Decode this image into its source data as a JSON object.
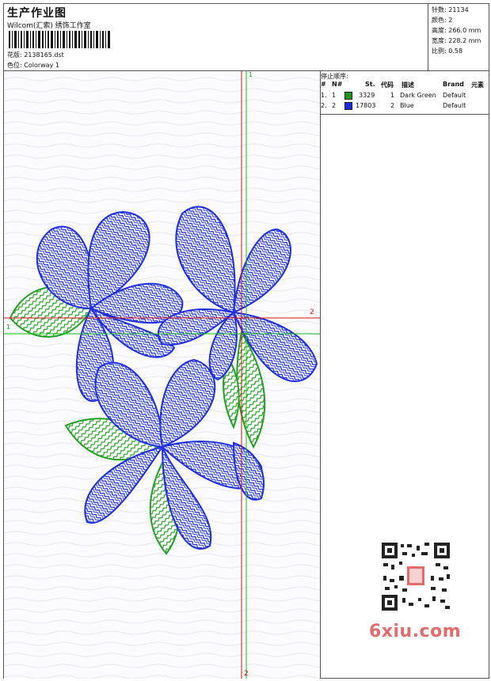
{
  "header": {
    "title": "生产作业图",
    "company": "Wilcom(汇索) 绣饰工作室",
    "design_label": "花版:",
    "design_value": "2138165.dst",
    "colorway_label": "色位:",
    "colorway_value": "Colorway 1"
  },
  "stats": {
    "stitches_label": "针数:",
    "stitches_value": "21134",
    "colors_label": "颜色:",
    "colors_value": "2",
    "height_label": "高度:",
    "height_value": "266.0 mm",
    "width_label": "宽度:",
    "width_value": "228.2 mm",
    "scale_label": "比例:",
    "scale_value": "0.58"
  },
  "stop_sequence": {
    "title": "停止顺序:",
    "columns": [
      "#",
      "N#",
      "St.",
      "代码",
      "描述",
      "Brand",
      "元素"
    ],
    "rows": [
      {
        "index": "1.",
        "needle": "1",
        "stitches": "3329",
        "code": "1",
        "description": "Dark Green",
        "brand": "Default",
        "color": "#1a9a1a"
      },
      {
        "index": "2.",
        "needle": "2",
        "stitches": "17803",
        "code": "2",
        "description": "Blue",
        "brand": "Default",
        "color": "#1a2be8"
      }
    ]
  },
  "guides": {
    "vertical_top_label": "1",
    "vertical_bottom_label": "2",
    "horizontal_left_label": "1",
    "horizontal_right_label": "2"
  },
  "colors": {
    "embroidery_blue": "#1f2fe0",
    "embroidery_green": "#22a022",
    "guide_red": "#e01010",
    "guide_green": "#10c010"
  },
  "watermark": {
    "text": "6xiu.com"
  }
}
